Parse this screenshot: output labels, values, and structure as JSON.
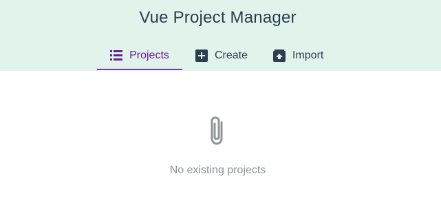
{
  "app": {
    "title": "Vue Project Manager"
  },
  "tabs": [
    {
      "label": "Projects",
      "icon": "list-icon",
      "active": true
    },
    {
      "label": "Create",
      "icon": "add-box-icon",
      "active": false
    },
    {
      "label": "Import",
      "icon": "unarchive-icon",
      "active": false
    }
  ],
  "empty_state": {
    "icon": "paperclip-icon",
    "message": "No existing projects"
  },
  "colors": {
    "header_bg": "#e2f3ec",
    "active_tab": "#6a1b9a",
    "text": "#2c3e50",
    "muted": "#8e9498"
  }
}
